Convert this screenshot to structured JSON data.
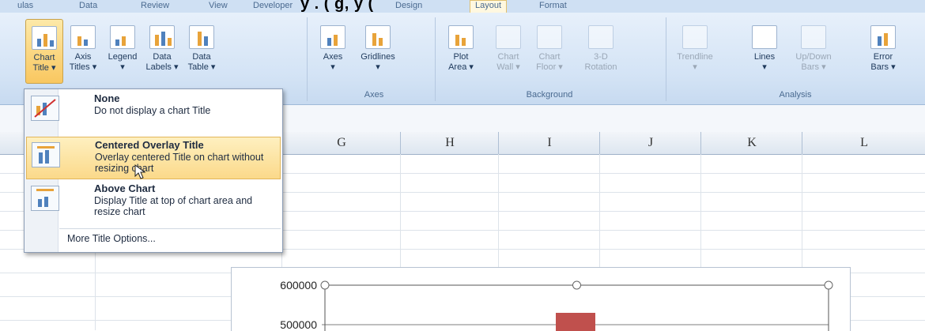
{
  "tabs": [
    {
      "label": "ulas",
      "active": false
    },
    {
      "label": "Data",
      "active": false
    },
    {
      "label": "Review",
      "active": false
    },
    {
      "label": "View",
      "active": false
    },
    {
      "label": "Developer",
      "active": false
    },
    {
      "label": "Design",
      "active": false
    },
    {
      "label": "Layout",
      "active": true
    },
    {
      "label": "Format",
      "active": false
    }
  ],
  "caption": "y   .   (        g,       y       (",
  "ribbon": {
    "buttons": [
      {
        "label1": "Chart",
        "label2": "Title ▾",
        "name": "chart-title-button",
        "selected": true,
        "dim": false
      },
      {
        "label1": "Axis",
        "label2": "Titles ▾",
        "name": "axis-titles-button",
        "selected": false,
        "dim": false
      },
      {
        "label1": "Legend",
        "label2": "▾",
        "name": "legend-button",
        "selected": false,
        "dim": false
      },
      {
        "label1": "Data",
        "label2": "Labels ▾",
        "name": "data-labels-button",
        "selected": false,
        "dim": false
      },
      {
        "label1": "Data",
        "label2": "Table ▾",
        "name": "data-table-button",
        "selected": false,
        "dim": false
      },
      {
        "label1": "Axes",
        "label2": "▾",
        "name": "axes-button",
        "selected": false,
        "dim": false
      },
      {
        "label1": "Gridlines",
        "label2": "▾",
        "name": "gridlines-button",
        "selected": false,
        "dim": false
      },
      {
        "label1": "Plot",
        "label2": "Area ▾",
        "name": "plot-area-button",
        "selected": false,
        "dim": false
      },
      {
        "label1": "Chart",
        "label2": "Wall ▾",
        "name": "chart-wall-button",
        "selected": false,
        "dim": true
      },
      {
        "label1": "Chart",
        "label2": "Floor ▾",
        "name": "chart-floor-button",
        "selected": false,
        "dim": true
      },
      {
        "label1": "3-D",
        "label2": "Rotation",
        "name": "3d-rotation-button",
        "selected": false,
        "dim": true
      },
      {
        "label1": "Trendline",
        "label2": "▾",
        "name": "trendline-button",
        "selected": false,
        "dim": true
      },
      {
        "label1": "Lines",
        "label2": "▾",
        "name": "lines-button",
        "selected": false,
        "dim": false
      },
      {
        "label1": "Up/Down",
        "label2": "Bars ▾",
        "name": "up-down-bars-button",
        "selected": false,
        "dim": true
      },
      {
        "label1": "Error",
        "label2": "Bars ▾",
        "name": "error-bars-button",
        "selected": false,
        "dim": false
      }
    ],
    "groups": [
      "Axes",
      "Background",
      "Analysis"
    ]
  },
  "columns": [
    "G",
    "H",
    "I",
    "J",
    "K",
    "L"
  ],
  "menu": {
    "items": [
      {
        "title": "None",
        "desc": "Do not display a chart Title",
        "highlighted": false
      },
      {
        "title": "Centered Overlay Title",
        "desc": "Overlay centered Title on chart without resizing chart",
        "highlighted": true
      },
      {
        "title": "Above Chart",
        "desc": "Display Title at top of chart area and resize chart",
        "highlighted": false
      }
    ],
    "more": "More Title Options..."
  },
  "chart_data": {
    "type": "bar",
    "y_ticks": [
      "600000",
      "500000"
    ],
    "ylim": [
      0,
      600000
    ],
    "series": [
      {
        "values": [
          530000
        ],
        "color": "#c0504d"
      }
    ]
  },
  "colors": {
    "accent": "#f9c760",
    "ribbon": "#d3e3f5",
    "bar": "#c0504d"
  }
}
